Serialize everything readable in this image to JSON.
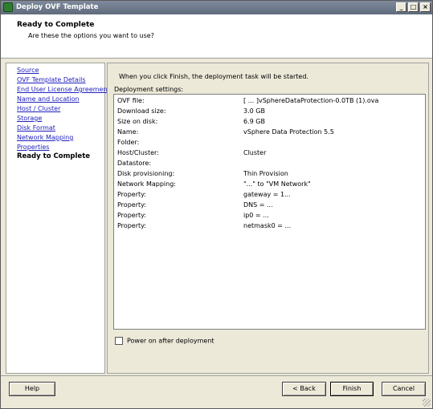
{
  "window": {
    "title": "Deploy OVF Template"
  },
  "header": {
    "title": "Ready to Complete",
    "subtitle": "Are these the options you want to use?"
  },
  "nav": {
    "items": [
      {
        "label": "Source",
        "current": false
      },
      {
        "label": "OVF Template Details",
        "current": false
      },
      {
        "label": "End User License Agreement",
        "current": false
      },
      {
        "label": "Name and Location",
        "current": false
      },
      {
        "label": "Host / Cluster",
        "current": false
      },
      {
        "label": "Storage",
        "current": false
      },
      {
        "label": "Disk Format",
        "current": false
      },
      {
        "label": "Network Mapping",
        "current": false
      },
      {
        "label": "Properties",
        "current": false
      },
      {
        "label": "Ready to Complete",
        "current": true
      }
    ]
  },
  "main": {
    "intro": "When you click Finish, the deployment task will be started.",
    "settings_label": "Deployment settings:",
    "settings": [
      {
        "key": "OVF file:",
        "value": "[ ... ]vSphereDataProtection-0.0TB (1).ova"
      },
      {
        "key": "Download size:",
        "value": "3.0 GB"
      },
      {
        "key": "Size on disk:",
        "value": "6.9 GB"
      },
      {
        "key": "Name:",
        "value": "vSphere Data Protection 5.5"
      },
      {
        "key": "Folder:",
        "value": ""
      },
      {
        "key": "Host/Cluster:",
        "value": "Cluster"
      },
      {
        "key": "Datastore:",
        "value": ""
      },
      {
        "key": "Disk provisioning:",
        "value": "Thin Provision"
      },
      {
        "key": "Network Mapping:",
        "value": "\"...\" to \"VM Network\""
      },
      {
        "key": "Property:",
        "value": "gateway = 1..."
      },
      {
        "key": "Property:",
        "value": "DNS = ..."
      },
      {
        "key": "Property:",
        "value": "ip0 = ..."
      },
      {
        "key": "Property:",
        "value": "netmask0 = ..."
      }
    ],
    "power_on_label": "Power on after deployment",
    "power_on_checked": false
  },
  "buttons": {
    "help": "Help",
    "back": "< Back",
    "finish": "Finish",
    "cancel": "Cancel"
  },
  "title_buttons": {
    "minimize": "_",
    "maximize": "□",
    "close": "×"
  }
}
